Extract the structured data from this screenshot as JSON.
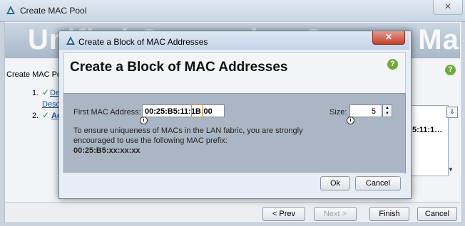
{
  "outer": {
    "title": "Create MAC Pool",
    "close_glyph": "✕",
    "banner_text": "Unified Computing System Manager",
    "wizard_caption": "Create MAC Pool",
    "steps": [
      {
        "num": "1.",
        "label": "Define",
        "sub": "Desc"
      },
      {
        "num": "2.",
        "label": "Add"
      }
    ],
    "table_preview": "5:11:1…",
    "buttons": {
      "prev": "< Prev",
      "next": "Next >",
      "finish": "Finish",
      "cancel": "Cancel"
    }
  },
  "dialog": {
    "title": "Create a Block of MAC Addresses",
    "heading": "Create a Block of MAC Addresses",
    "close_glyph": "✕",
    "help_glyph": "?",
    "fields": {
      "first_mac_label": "First MAC Address:",
      "first_mac_value": "00:25:B5:11:1B:00",
      "size_label": "Size:",
      "size_value": "5"
    },
    "note_line1": "To ensure uniqueness of MACs in the LAN fabric, you are strongly",
    "note_line2": "encouraged to use the following MAC prefix:",
    "prefix": "00:25:B5:xx:xx:xx",
    "buttons": {
      "ok": "Ok",
      "cancel": "Cancel"
    }
  },
  "icons": {
    "logo": "cisco-triangle-icon",
    "help": "help-icon",
    "info": "info-icon",
    "spinner": "spinner-icon",
    "menu": "table-menu-icon"
  },
  "colors": {
    "help_green": "#6fa83b",
    "close_red": "#c4412c",
    "link_blue": "#1a4f9a"
  }
}
